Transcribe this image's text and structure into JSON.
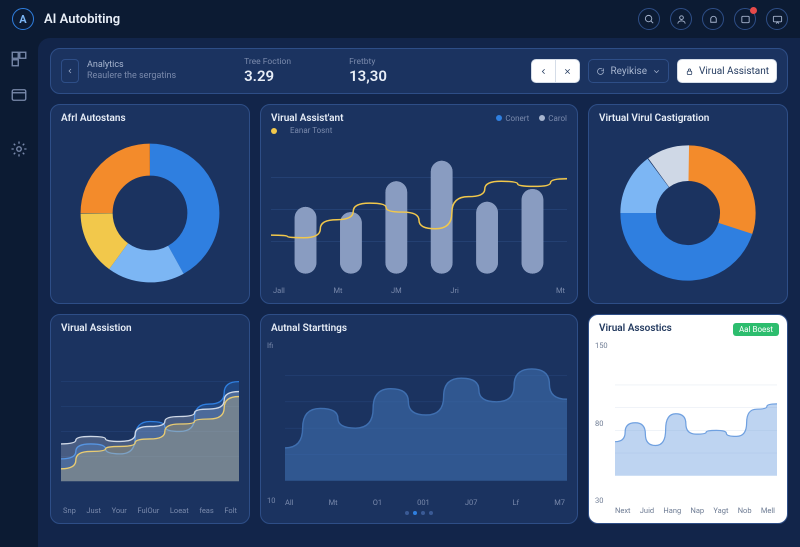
{
  "app": {
    "logo_letter": "A",
    "title": "AI Autobiting"
  },
  "topbar_icons": [
    "search",
    "user",
    "bell",
    "notification",
    "chat"
  ],
  "rail": [
    "grid",
    "window",
    "gear"
  ],
  "header": {
    "breadcrumb": {
      "line1": "Analytics",
      "line2": "Reaulere the sergatins"
    },
    "metric1": {
      "label": "Tree Foction",
      "value": "3.29"
    },
    "metric2": {
      "label": "Fretbty",
      "value": "13,30"
    },
    "segment": {
      "back": "<",
      "close": "✕"
    },
    "refresh": {
      "label": "Reyikise"
    },
    "assistant": {
      "label": "Virual Assistant"
    }
  },
  "colors": {
    "blue": "#2f7fe0",
    "bluelight": "#7cb6f4",
    "orange": "#f38b2b",
    "yellow": "#f2c84b",
    "green": "#2dbd6e",
    "grey": "#a7b5cf"
  },
  "cards": {
    "donut1": {
      "title": "Afrl Autostans"
    },
    "bars": {
      "title": "Virual Assist'ant",
      "legend": [
        {
          "label": "Conert",
          "color": "#2f7fe0"
        },
        {
          "label": "Carol",
          "color": "#a7b5cf"
        }
      ],
      "series_label": "Eanar Tosnt"
    },
    "donut2": {
      "title": "Virtual Virul Castigration"
    },
    "area1": {
      "title": "Virual Assistion"
    },
    "area2": {
      "title": "Autnal Starttings"
    },
    "area3": {
      "title": "Virual Assostics",
      "badge": "Aal Boest"
    }
  },
  "chart_data": [
    {
      "id": "donut1",
      "type": "pie",
      "series": [
        {
          "name": "orange",
          "value": 25,
          "color": "#f38b2b"
        },
        {
          "name": "yellow",
          "value": 15,
          "color": "#f2c84b"
        },
        {
          "name": "lightblue",
          "value": 18,
          "color": "#7cb6f4"
        },
        {
          "name": "blue",
          "value": 42,
          "color": "#2f7fe0"
        }
      ]
    },
    {
      "id": "bars",
      "type": "bar",
      "categories": [
        "Jall",
        "Mt",
        "JM",
        "Jri",
        "",
        "Mt"
      ],
      "values": [
        52,
        48,
        72,
        88,
        56,
        66
      ],
      "overlay_line": [
        30,
        28,
        42,
        55,
        48,
        35,
        60,
        72,
        68,
        74
      ],
      "ylim": [
        0,
        100
      ]
    },
    {
      "id": "donut2",
      "type": "pie",
      "series": [
        {
          "name": "orange",
          "value": 30,
          "color": "#f38b2b"
        },
        {
          "name": "blue",
          "value": 45,
          "color": "#2f7fe0"
        },
        {
          "name": "lightblue",
          "value": 15,
          "color": "#7cb6f4"
        },
        {
          "name": "grey",
          "value": 10,
          "color": "#cfd8e6"
        }
      ]
    },
    {
      "id": "area1",
      "type": "area",
      "categories": [
        "Snp",
        "Just",
        "Your",
        "FulOur",
        "Loeat",
        "feas",
        "Folt"
      ],
      "series": [
        {
          "name": "blue",
          "color": "#2f7fe0",
          "values": [
            18,
            30,
            22,
            48,
            40,
            62,
            80
          ]
        },
        {
          "name": "yellow",
          "color": "#f2c84b",
          "values": [
            10,
            24,
            28,
            34,
            46,
            50,
            68
          ]
        },
        {
          "name": "grey",
          "color": "#cfd8e6",
          "values": [
            30,
            36,
            32,
            44,
            52,
            58,
            72
          ]
        }
      ],
      "ylim": [
        0,
        100
      ]
    },
    {
      "id": "area2",
      "type": "area",
      "categories": [
        "All",
        "Mt",
        "O1",
        "001",
        "J07",
        "Lf",
        "M7"
      ],
      "yticks": [
        "Ifi",
        "10"
      ],
      "series": [
        {
          "name": "blue",
          "color": "#3f6fb0",
          "values": [
            25,
            55,
            40,
            70,
            50,
            78,
            60,
            85,
            62
          ]
        }
      ],
      "ylim": [
        0,
        100
      ]
    },
    {
      "id": "area3",
      "type": "area",
      "categories": [
        "Next",
        "Juid",
        "Hang",
        "Nap",
        "Yagt",
        "Nob",
        "Mell"
      ],
      "yticks": [
        "150",
        "80",
        "30"
      ],
      "series": [
        {
          "name": "blue",
          "color": "#6fa0e0",
          "values": [
            45,
            70,
            40,
            82,
            55,
            60,
            52,
            88,
            95
          ]
        }
      ],
      "ylim": [
        0,
        150
      ]
    }
  ]
}
